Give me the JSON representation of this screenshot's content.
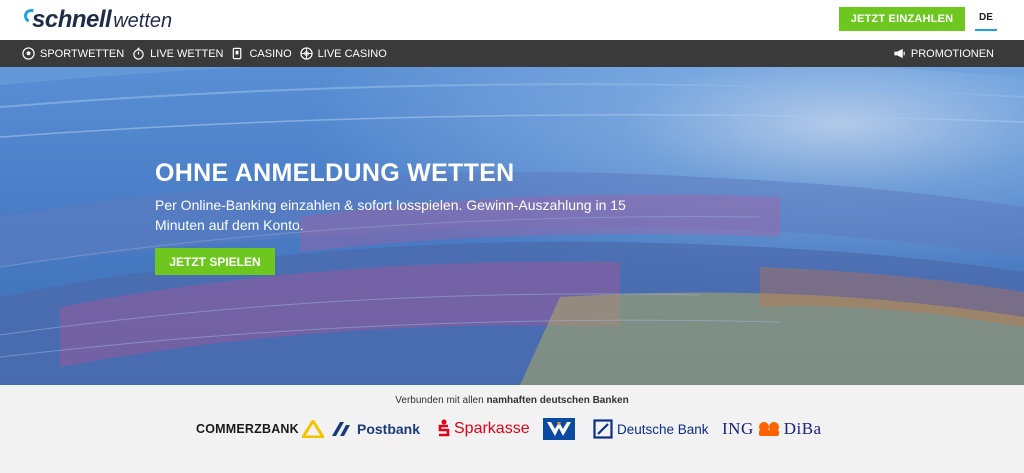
{
  "header": {
    "logo_main": "schnell",
    "logo_sub": "wetten",
    "deposit_label": "JETZT EINZAHLEN",
    "language": "DE"
  },
  "nav": {
    "items": [
      {
        "label": "SPORTWETTEN",
        "icon": "soccer-ball-icon"
      },
      {
        "label": "LIVE WETTEN",
        "icon": "stopwatch-icon"
      },
      {
        "label": "CASINO",
        "icon": "cards-icon"
      },
      {
        "label": "LIVE CASINO",
        "icon": "roulette-icon"
      }
    ],
    "promotions": {
      "label": "PROMOTIONEN",
      "icon": "megaphone-icon"
    }
  },
  "hero": {
    "title": "OHNE ANMELDUNG WETTEN",
    "text": "Per Online-Banking einzahlen & sofort losspielen. Gewinn-Auszahlung in 15 Minuten auf dem Konto.",
    "cta_label": "JETZT SPIELEN"
  },
  "banks": {
    "caption_prefix": "Verbunden mit allen ",
    "caption_bold": "namhaften deutschen Banken",
    "items": [
      {
        "name": "COMMERZBANK"
      },
      {
        "name": "Postbank"
      },
      {
        "name": "Sparkasse"
      },
      {
        "name": "Deutsche Bank"
      },
      {
        "name_left": "ING",
        "name_right": "DiBa"
      }
    ]
  },
  "colors": {
    "accent_green": "#6dc71f",
    "nav_bg": "#3a3a3a",
    "brand_blue": "#1da1e6",
    "logo_navy": "#1f2b47"
  }
}
